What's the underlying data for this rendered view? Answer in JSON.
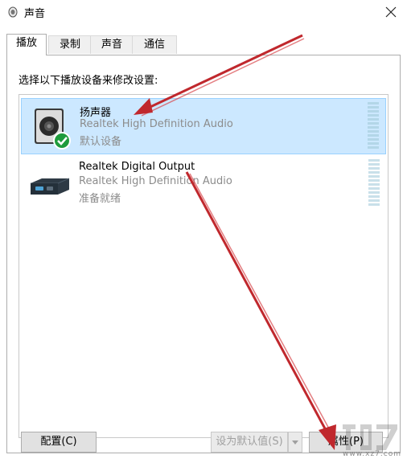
{
  "window": {
    "title": "声音"
  },
  "tabs": [
    {
      "label": "播放",
      "active": true
    },
    {
      "label": "录制",
      "active": false
    },
    {
      "label": "声音",
      "active": false
    },
    {
      "label": "通信",
      "active": false
    }
  ],
  "panel": {
    "instruction": "选择以下播放设备来修改设置:"
  },
  "devices": [
    {
      "name": "扬声器",
      "driver": "Realtek High Definition Audio",
      "status": "默认设备",
      "selected": true,
      "icon": "speaker-icon"
    },
    {
      "name": "Realtek Digital Output",
      "driver": "Realtek High Definition Audio",
      "status": "准备就绪",
      "selected": false,
      "icon": "digital-output-icon"
    }
  ],
  "buttons": {
    "configure": "配置(C)",
    "set_default": "设为默认值(S)",
    "properties": "属性(P)"
  },
  "watermark": {
    "text": "www.xz7.com"
  },
  "colors": {
    "selection": "#cce8ff",
    "annotation_arrow": "#c0282d",
    "default_check": "#1e9b3c"
  }
}
